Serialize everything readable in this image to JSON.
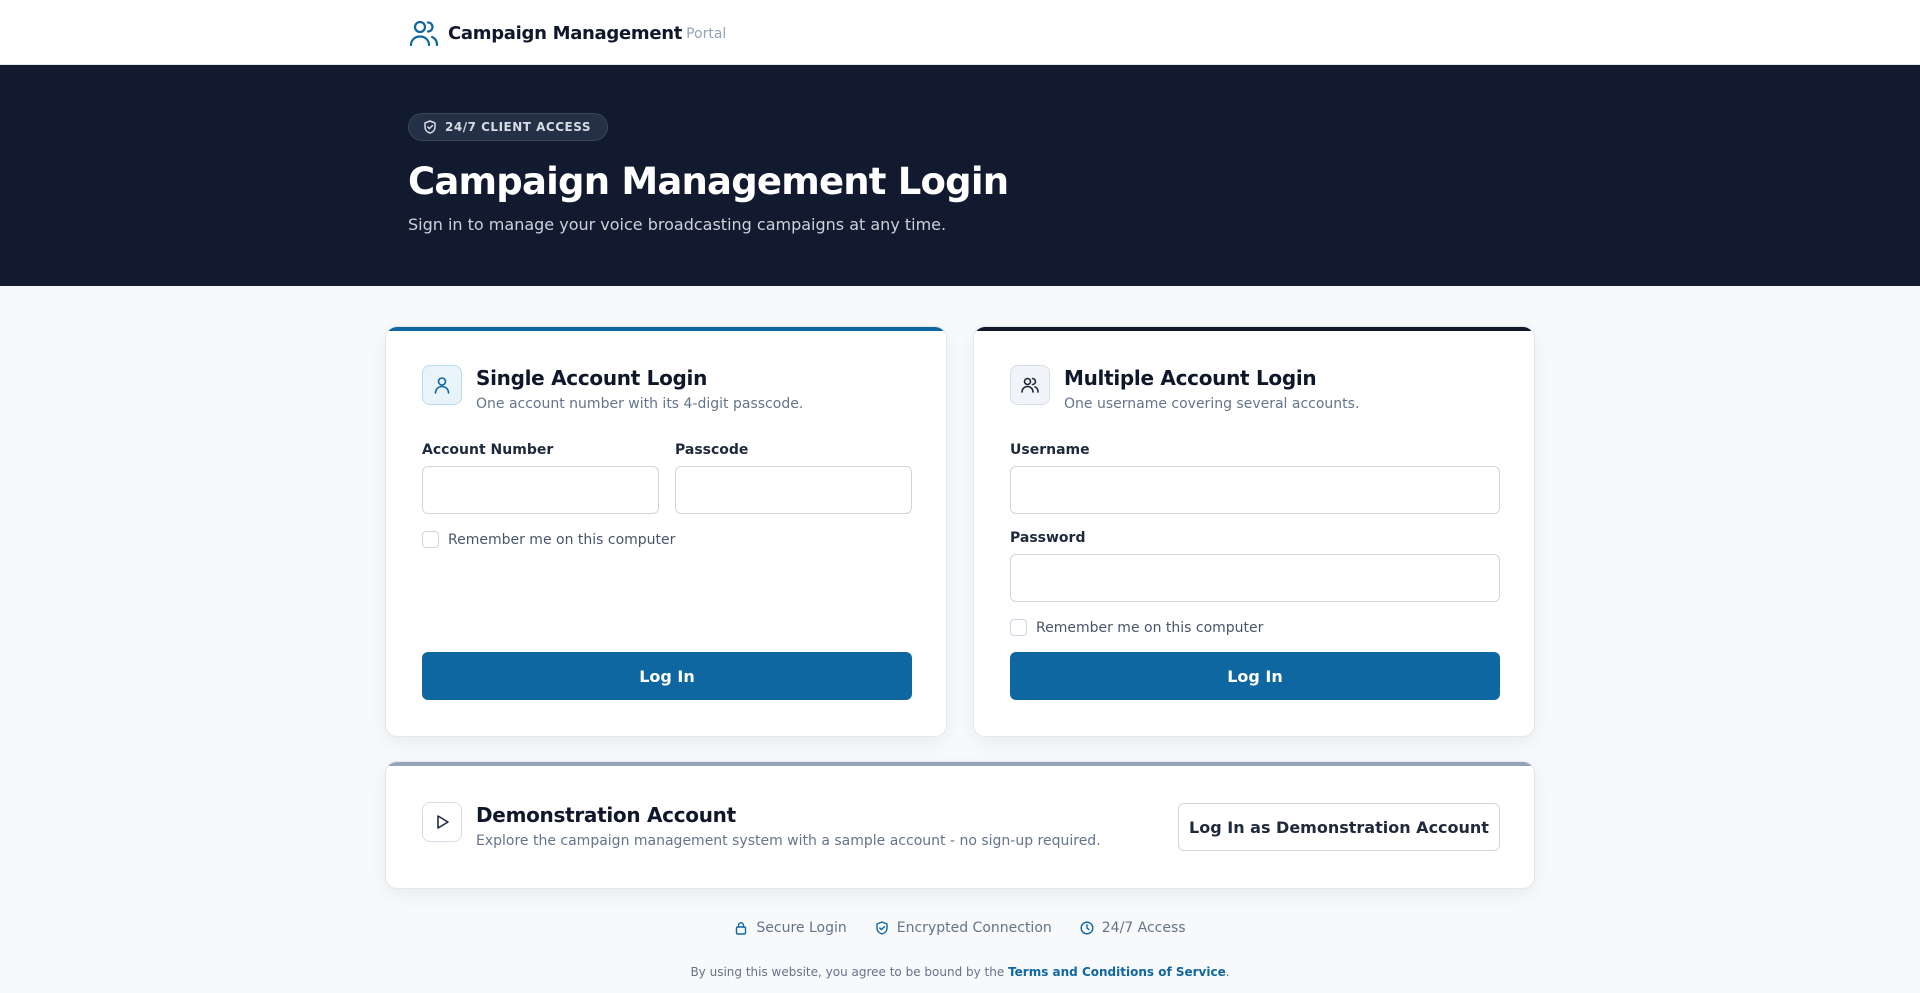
{
  "header": {
    "brand_name": "Campaign Management",
    "brand_sub": "Portal"
  },
  "hero": {
    "badge": "24/7 CLIENT ACCESS",
    "title": "Campaign Management Login",
    "subtitle": "Sign in to manage your voice broadcasting campaigns at any time."
  },
  "single": {
    "title": "Single Account Login",
    "description": "One account number with its 4-digit passcode.",
    "account_label": "Account Number",
    "account_value": "",
    "passcode_label": "Passcode",
    "passcode_value": "",
    "remember_label": "Remember me on this computer",
    "button_label": "Log In"
  },
  "multiple": {
    "title": "Multiple Account Login",
    "description": "One username covering several accounts.",
    "username_label": "Username",
    "username_value": "",
    "password_label": "Password",
    "password_value": "",
    "remember_label": "Remember me on this computer",
    "button_label": "Log In"
  },
  "demo": {
    "title": "Demonstration Account",
    "description": "Explore the campaign management system with a sample account - no sign-up required.",
    "button_label": "Log In as Demonstration Account"
  },
  "footer": {
    "features": [
      "Secure Login",
      "Encrypted Connection",
      "24/7 Access"
    ],
    "terms_prefix": "By using this website, you agree to be bound by the",
    "terms_link": "Terms and Conditions of Service",
    "terms_suffix": "."
  },
  "colors": {
    "primary": "#0e67a0",
    "hero_bg": "#111a2e",
    "single_accent": "#0e67a0",
    "multiple_accent": "#111827",
    "demo_accent": "#94a3b8"
  },
  "icons": {
    "brand": "users-icon",
    "badge": "shield-check-icon",
    "single": "user-icon",
    "multiple": "users-icon",
    "demo": "play-icon",
    "features": [
      "lock-icon",
      "shield-check-icon",
      "clock-icon"
    ]
  }
}
